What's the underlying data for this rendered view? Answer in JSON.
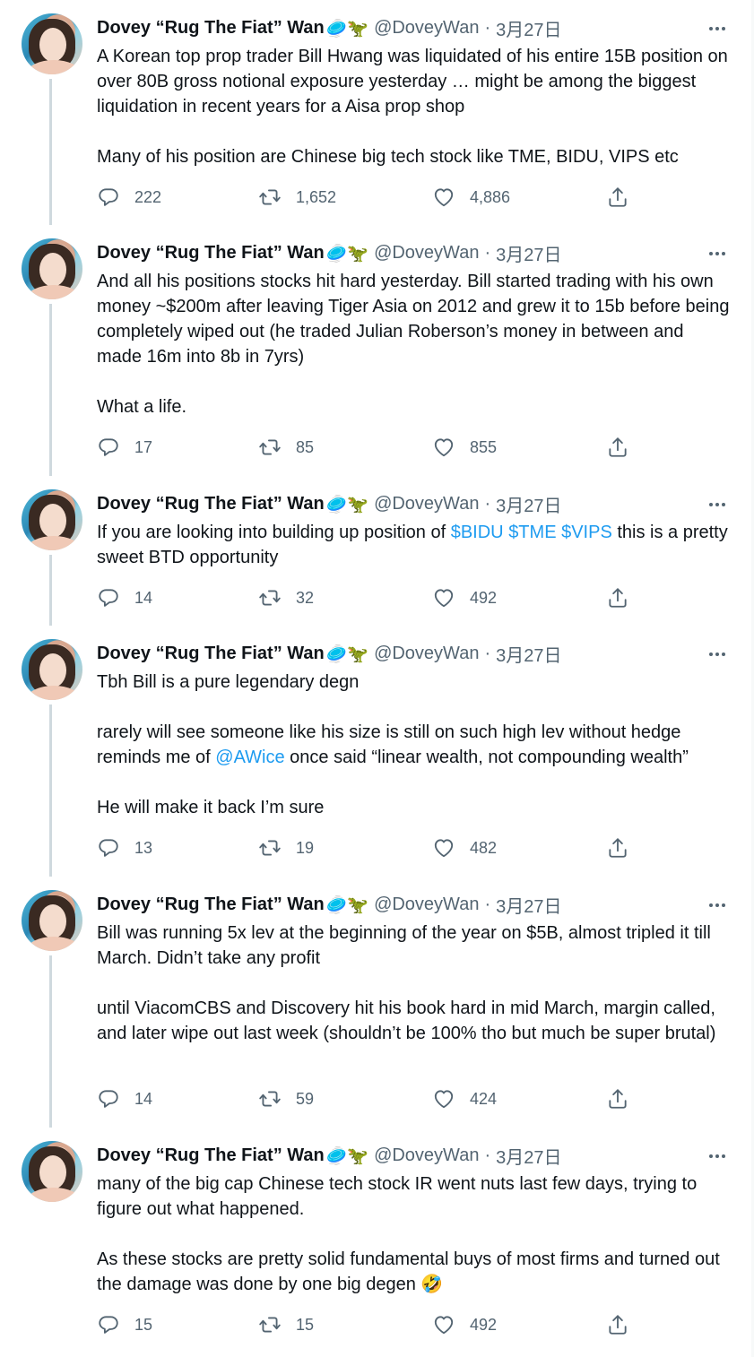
{
  "tweets": [
    {
      "name": "Dovey “Rug The Fiat” Wan",
      "emoji": "🥏🦖",
      "handle": "@DoveyWan",
      "date": "3月27日",
      "paragraphs": [
        [
          {
            "t": "A Korean top prop trader Bill Hwang was liquidated of his entire 15B position on over 80B gross notional exposure yesterday … might be among the biggest liquidation in recent years for a Aisa prop shop"
          }
        ],
        [
          {
            "t": "Many of his position are Chinese big tech stock like TME, BIDU, VIPS etc"
          }
        ]
      ],
      "replies": "222",
      "retweets": "1,652",
      "likes": "4,886"
    },
    {
      "name": "Dovey “Rug The Fiat” Wan",
      "emoji": "🥏🦖",
      "handle": "@DoveyWan",
      "date": "3月27日",
      "paragraphs": [
        [
          {
            "t": "And all his positions stocks hit hard yesterday. Bill started trading with his own money ~$200m after leaving Tiger Asia on 2012 and grew it to 15b before being completely wiped out (he traded Julian Roberson’s money in between and made 16m into 8b in 7yrs)"
          }
        ],
        [
          {
            "t": "What a life."
          }
        ]
      ],
      "replies": "17",
      "retweets": "85",
      "likes": "855"
    },
    {
      "name": "Dovey “Rug The Fiat” Wan",
      "emoji": "🥏🦖",
      "handle": "@DoveyWan",
      "date": "3月27日",
      "paragraphs": [
        [
          {
            "t": "If you are looking into building up position of "
          },
          {
            "t": "$BIDU",
            "link": true
          },
          {
            "t": " "
          },
          {
            "t": "$TME",
            "link": true
          },
          {
            "t": " "
          },
          {
            "t": "$VIPS",
            "link": true
          },
          {
            "t": " this is a pretty sweet BTD opportunity"
          }
        ]
      ],
      "replies": "14",
      "retweets": "32",
      "likes": "492"
    },
    {
      "name": "Dovey “Rug The Fiat” Wan",
      "emoji": "🥏🦖",
      "handle": "@DoveyWan",
      "date": "3月27日",
      "paragraphs": [
        [
          {
            "t": "Tbh Bill is a pure legendary degn"
          }
        ],
        [
          {
            "t": "rarely will see someone like his size is still on such high lev without hedge reminds me of "
          },
          {
            "t": "@AWice",
            "link": true
          },
          {
            "t": " once said “linear wealth, not compounding wealth”"
          }
        ],
        [
          {
            "t": "He will make it back I’m sure"
          }
        ]
      ],
      "replies": "13",
      "retweets": "19",
      "likes": "482"
    },
    {
      "name": "Dovey “Rug The Fiat” Wan",
      "emoji": "🥏🦖",
      "handle": "@DoveyWan",
      "date": "3月27日",
      "paragraphs": [
        [
          {
            "t": "Bill was running 5x lev at the beginning of the year on $5B, almost tripled it till March. Didn’t take any profit"
          }
        ],
        [
          {
            "t": "until ViacomCBS and Discovery hit his book hard in mid March, margin called, and later wipe out last week (shouldn’t be 100% tho but much be super brutal)"
          }
        ]
      ],
      "replies": "14",
      "retweets": "59",
      "likes": "424"
    },
    {
      "name": "Dovey “Rug The Fiat” Wan",
      "emoji": "🥏🦖",
      "handle": "@DoveyWan",
      "date": "3月27日",
      "paragraphs": [
        [
          {
            "t": "many of the big cap Chinese tech stock IR went nuts last few days, trying to figure out what happened."
          }
        ],
        [
          {
            "t": "As these stocks are pretty solid fundamental buys of most firms and turned out the damage was done by one big degen 🤣"
          }
        ]
      ],
      "replies": "15",
      "retweets": "15",
      "likes": "492"
    }
  ],
  "colors": {
    "link": "#1d9bf0",
    "muted": "#536471",
    "text": "#0f1419",
    "thread_line": "#cfd9de"
  },
  "icons": {
    "reply": "reply-icon",
    "retweet": "retweet-icon",
    "like": "heart-icon",
    "share": "share-icon",
    "more": "more-icon"
  }
}
